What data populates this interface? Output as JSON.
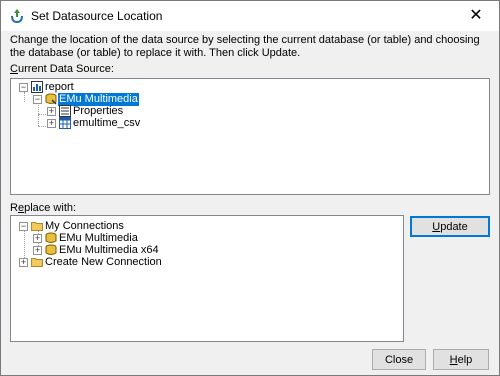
{
  "window": {
    "title": "Set Datasource Location",
    "close_glyph": "✕"
  },
  "instructions": "Change the location of the data source by selecting the current database (or table) and choosing the database (or table) to replace it with.  Then click Update.",
  "current_label": {
    "pre": "",
    "accel": "C",
    "post": "urrent Data Source:"
  },
  "replace_label": {
    "pre": "R",
    "accel": "e",
    "post": "place with:"
  },
  "current_tree": {
    "report": "report",
    "db": "EMu Multimedia",
    "properties": "Properties",
    "table": "emultime_csv"
  },
  "replace_tree": {
    "my_connections": "My Connections",
    "conn1": "EMu Multimedia",
    "conn2": "EMu Multimedia x64",
    "create_new": "Create New Connection"
  },
  "buttons": {
    "update": {
      "accel": "U",
      "rest": "pdate"
    },
    "close": {
      "label": "Close"
    },
    "help": {
      "accel": "H",
      "rest": "elp"
    }
  },
  "colors": {
    "selection": "#0078d7",
    "folder": "#f3c85c"
  }
}
